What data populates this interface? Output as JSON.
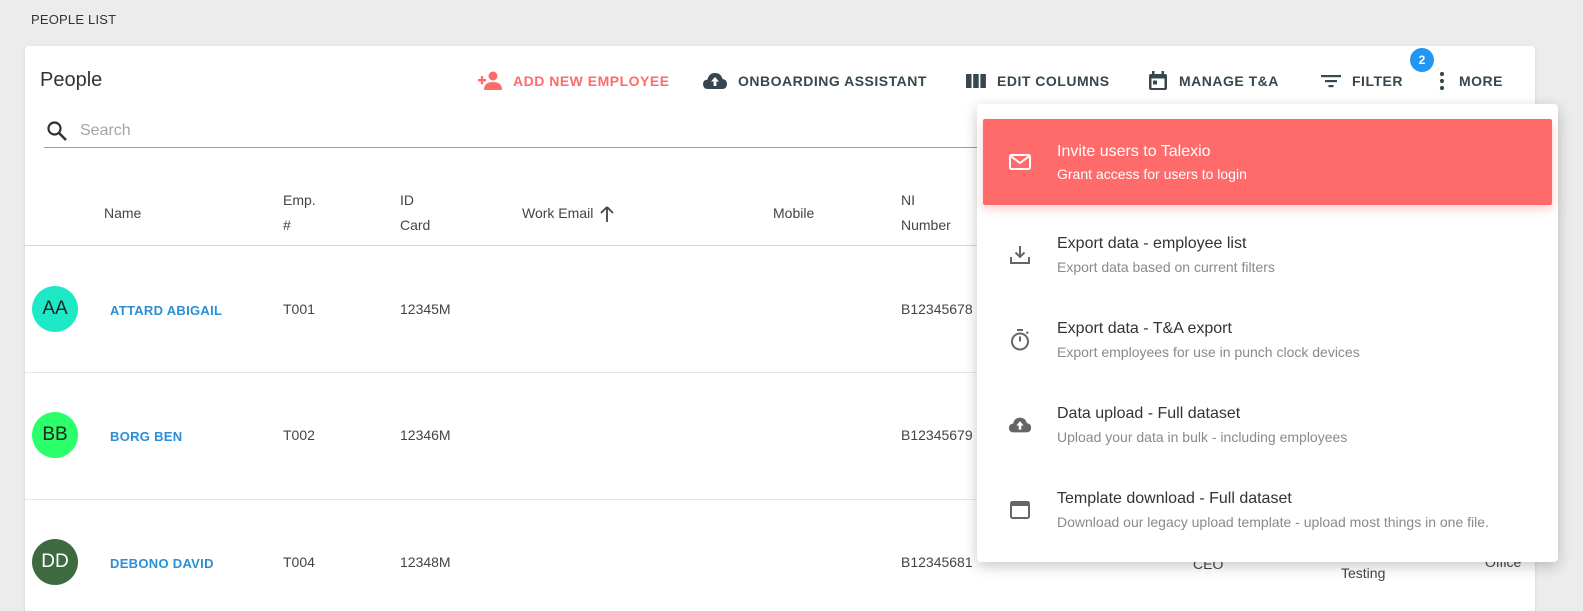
{
  "page_label": "PEOPLE LIST",
  "card": {
    "title": "People",
    "toolbar": {
      "add_new_employee": "ADD NEW EMPLOYEE",
      "onboarding_assistant": "ONBOARDING ASSISTANT",
      "edit_columns": "EDIT COLUMNS",
      "manage_ta": "MANAGE T&A",
      "filter": "FILTER",
      "filter_badge": "2",
      "more": "MORE"
    },
    "search": {
      "placeholder": "Search",
      "value": ""
    }
  },
  "table": {
    "headers": {
      "name": "Name",
      "emp_line1": "Emp.",
      "emp_line2": "#",
      "id_line1": "ID",
      "id_line2": "Card",
      "work_email": "Work Email",
      "mobile": "Mobile",
      "ni_line1": "NI",
      "ni_line2": "Number"
    },
    "rows": [
      {
        "initials": "AA",
        "name": "ATTARD ABIGAIL",
        "emp": "T001",
        "id_card": "12345M",
        "ni": "B12345678"
      },
      {
        "initials": "BB",
        "name": "BORG BEN",
        "emp": "T002",
        "id_card": "12346M",
        "ni": "B12345679"
      },
      {
        "initials": "DD",
        "name": "DEBONO DAVID",
        "emp": "T004",
        "id_card": "12348M",
        "ni": "B12345681",
        "position": "CEO",
        "unit": "Testing",
        "location": "Office"
      }
    ]
  },
  "menu": {
    "items": [
      {
        "title": "Invite users to Talexio",
        "subtitle": "Grant access for users to login"
      },
      {
        "title": "Export data - employee list",
        "subtitle": "Export data based on current filters"
      },
      {
        "title": "Export data - T&A export",
        "subtitle": "Export employees for use in punch clock devices"
      },
      {
        "title": "Data upload - Full dataset",
        "subtitle": "Upload your data in bulk - including employees"
      },
      {
        "title": "Template download - Full dataset",
        "subtitle": "Download our legacy upload template - upload most things in one file."
      }
    ]
  },
  "colors": {
    "accent": "#ff6b6b",
    "link": "#2a8fd6",
    "badge": "#2196f3",
    "avatar_aa": "#1de9c6",
    "avatar_bb": "#2bff6a",
    "avatar_dd": "#3d6b3f"
  }
}
